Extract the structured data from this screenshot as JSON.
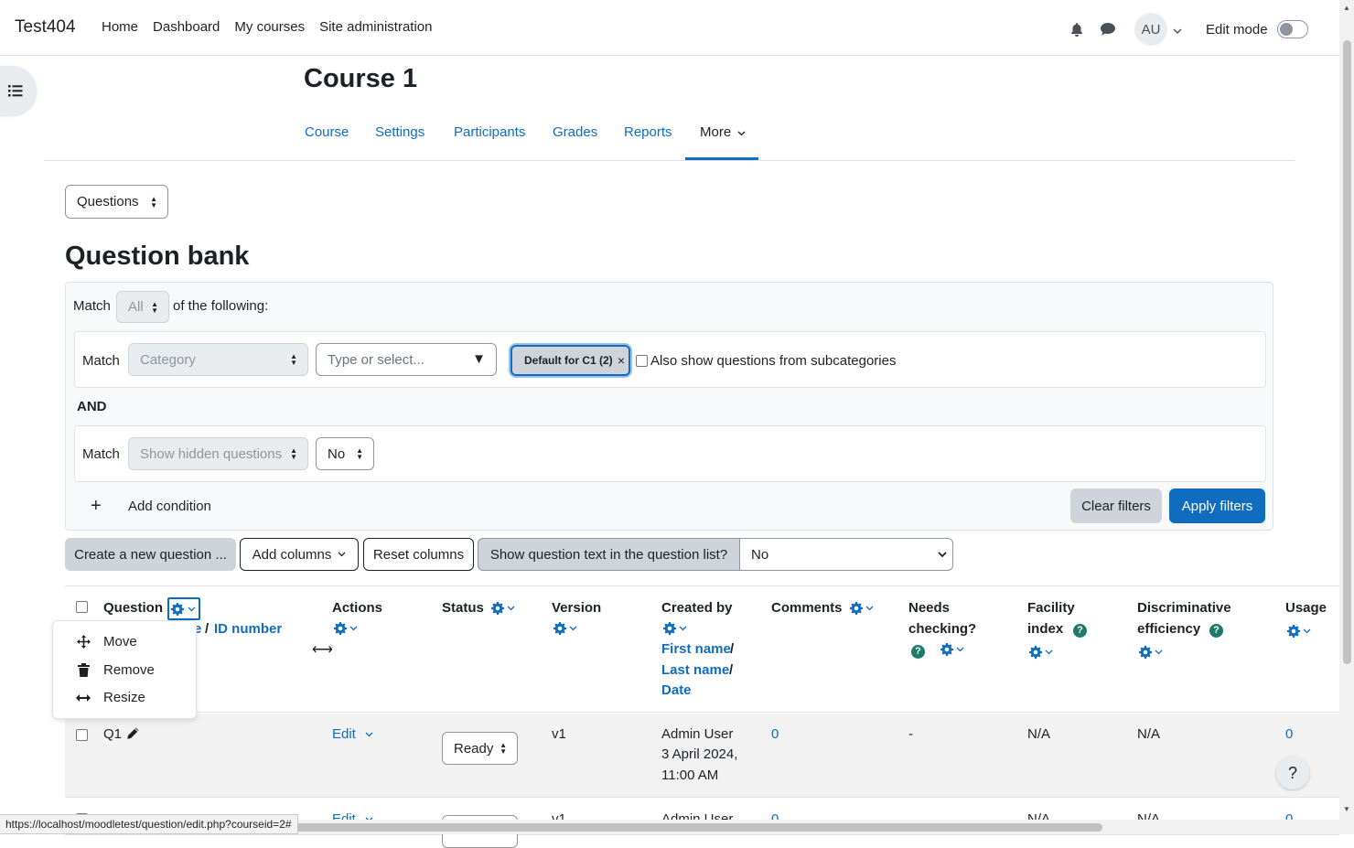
{
  "navbar": {
    "brand": "Test404",
    "links": [
      "Home",
      "Dashboard",
      "My courses",
      "Site administration"
    ],
    "avatar_initials": "AU",
    "edit_mode_label": "Edit mode"
  },
  "course": {
    "title": "Course 1",
    "tabs": [
      "Course",
      "Settings",
      "Participants",
      "Grades",
      "Reports",
      "More"
    ]
  },
  "page_select": {
    "value": "Questions"
  },
  "page_heading": "Question bank",
  "filters": {
    "match_label": "Match",
    "match_value": "All",
    "of_following": "of the following:",
    "row1": {
      "match_label": "Match",
      "type_value": "Category",
      "search_placeholder": "Type or select...",
      "chip": "Default for C1 (2)",
      "subcategories_label": "Also show questions from subcategories"
    },
    "and_label": "AND",
    "row2": {
      "match_label": "Match",
      "type_value": "Show hidden questions",
      "value": "No"
    },
    "add_condition": "Add condition",
    "clear_filters": "Clear filters",
    "apply_filters": "Apply filters"
  },
  "toolbar": {
    "create_question": "Create a new question ...",
    "add_columns": "Add columns",
    "reset_columns": "Reset columns",
    "show_text_label": "Show question text in the question list?",
    "show_text_value": "No"
  },
  "table": {
    "headers": {
      "question": "Question",
      "name_suffix": "e",
      "id_sep": "/",
      "id_number": "ID number",
      "actions": "Actions",
      "status": "Status",
      "version": "Version",
      "created_by": "Created by",
      "first_name": "First name",
      "last_name": "Last name",
      "slash": "/",
      "date": "Date",
      "comments": "Comments",
      "needs_checking_1": "Needs",
      "needs_checking_2": "checking?",
      "facility_1": "Facility",
      "facility_2": "index",
      "discrim_1": "Discriminative",
      "discrim_2": "efficiency",
      "usage": "Usage"
    },
    "rows": [
      {
        "name": "Q1",
        "action": "Edit",
        "status": "Ready",
        "version": "v1",
        "created_by": "Admin User",
        "created_date": "3 April 2024,",
        "created_time": "11:00 AM",
        "comments": "0",
        "needs_checking": "-",
        "facility": "N/A",
        "discrimination": "N/A",
        "usage": "0"
      },
      {
        "action": "Edit",
        "version": "v1",
        "created_by": "Admin User",
        "comments": "0",
        "facility": "N/A",
        "discrimination": "N/A",
        "usage": "0"
      }
    ]
  },
  "column_menu": {
    "items": [
      "Move",
      "Remove",
      "Resize"
    ]
  },
  "status_bar_url": "https://localhost/moodletest/question/edit.php?courseid=2#",
  "help_label": "?",
  "colors": {
    "primary": "#0f6cbf",
    "secondary_bg": "#ced4da",
    "help_icon": "#1f7a6a"
  }
}
